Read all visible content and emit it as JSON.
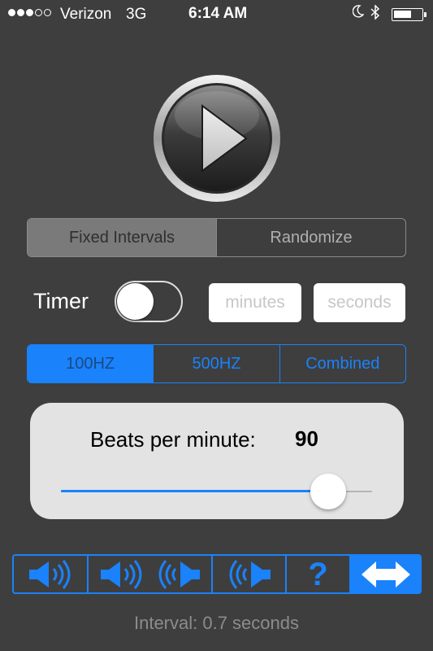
{
  "status_bar": {
    "carrier": "Verizon",
    "network": "3G",
    "time": "6:14 AM",
    "signal_bars": 3,
    "signal_total": 5,
    "icons": [
      "moon-icon",
      "bluetooth-icon",
      "battery-icon"
    ],
    "battery_level": 0.65
  },
  "play_button": {
    "icon": "play-icon"
  },
  "mode": {
    "options": [
      "Fixed Intervals",
      "Randomize"
    ],
    "selected": "Fixed Intervals"
  },
  "timer": {
    "label": "Timer",
    "enabled": false,
    "minutes_placeholder": "minutes",
    "seconds_placeholder": "seconds"
  },
  "frequency": {
    "options": [
      "100HZ",
      "500HZ",
      "Combined"
    ],
    "selected": "100HZ"
  },
  "bpm": {
    "label": "Beats per minute:",
    "value": "90",
    "slider_fraction": 0.86
  },
  "sound_bar": {
    "items": [
      {
        "icon": "speaker-right-icon"
      },
      {
        "icon": "speaker-both-icon"
      },
      {
        "icon": "speaker-left-icon"
      },
      {
        "icon": "help-icon",
        "glyph": "?"
      },
      {
        "icon": "swap-arrows-icon"
      }
    ],
    "active_index": 4
  },
  "interval_text": "Interval: 0.7 seconds",
  "colors": {
    "background": "#3e3e3e",
    "accent": "#1a82fb",
    "panel": "#e3e3e3"
  }
}
